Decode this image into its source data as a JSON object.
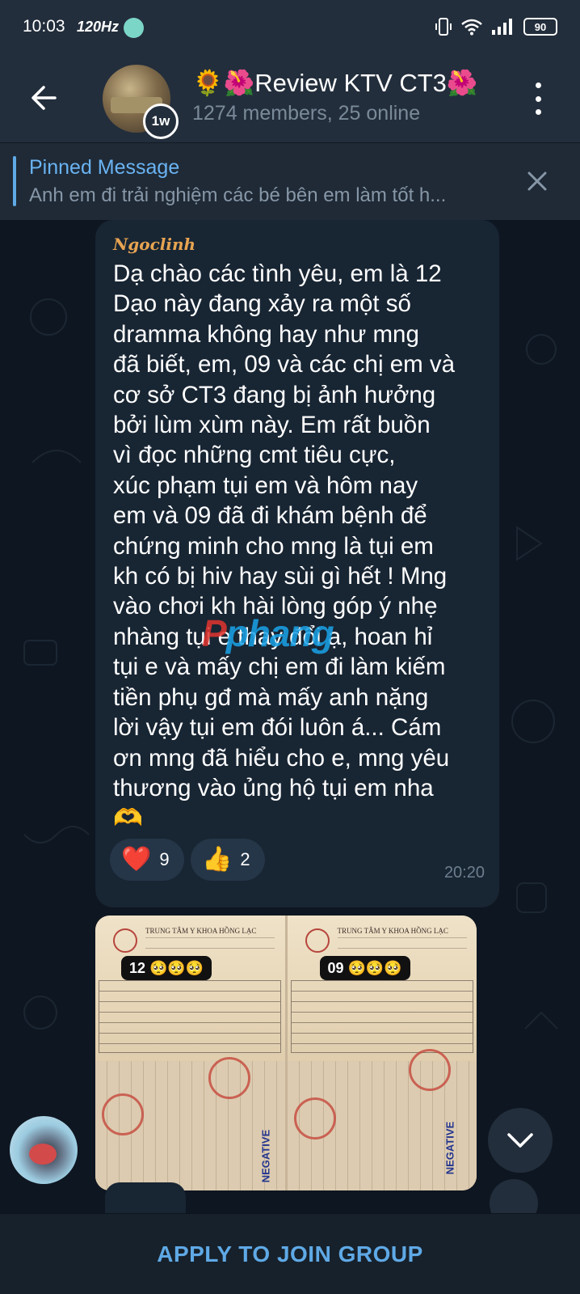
{
  "status_bar": {
    "time": "10:03",
    "refresh_rate": "120Hz",
    "battery": "90"
  },
  "header": {
    "title": "🌻🌺Review KTV CT3🌺",
    "subtitle": "1274 members, 25 online",
    "avatar_badge": "1w"
  },
  "pinned": {
    "title": "Pinned Message",
    "text": "Anh em đi trải nghiệm các bé bên em làm tốt h..."
  },
  "message": {
    "sender": "Ngoclinh",
    "text": "Dạ chào các tình yêu, em là 12\nDạo này đang xảy ra một số\ndramma không hay như mng\nđã biết, em, 09 và các chị em và\ncơ sở CT3 đang bị ảnh hưởng\nbởi lùm xùm này. Em rất buồn\nvì đọc những cmt tiêu cực,\nxúc phạm tụi em và hôm nay\nem và 09 đã đi khám bệnh để\nchứng minh cho mng là tụi em\nkh có bị hiv hay sùi gì hết ! Mng\nvào chơi kh hài lòng góp ý nhẹ\nnhàng tụi e thay đổi ạ, hoan hỉ\ntụi e và mấy chị em đi làm kiếm\ntiền phụ gđ mà mấy anh nặng\nlời vậy tụi em đói luôn á... Cám\nơn mng đã hiểu cho e, mng yêu\nthương vào ủng hộ tụi em nha\n🫶",
    "time": "20:20",
    "reactions": [
      {
        "emoji": "❤️",
        "count": "9"
      },
      {
        "emoji": "👍",
        "count": "2"
      }
    ]
  },
  "watermark": {
    "prefix": "P",
    "rest": "phang"
  },
  "album": {
    "photos": [
      {
        "tag": "12 🥺🥺🥺",
        "clinic_name": "TRUNG TÂM Y KHOA HỒNG LẠC",
        "negative_text": "NEGATIVE"
      },
      {
        "tag": "09 🥺🥺🥺",
        "clinic_name": "TRUNG TÂM Y KHOA HỒNG LẠC",
        "negative_text": "NEGATIVE"
      }
    ]
  },
  "bottom_bar": {
    "join_label": "APPLY TO JOIN GROUP"
  },
  "colors": {
    "header_bg": "#232e3c",
    "chat_bg": "#0e1621",
    "bubble_bg": "#182533",
    "accent": "#5fa9e6",
    "sender_color": "#e7a451"
  }
}
